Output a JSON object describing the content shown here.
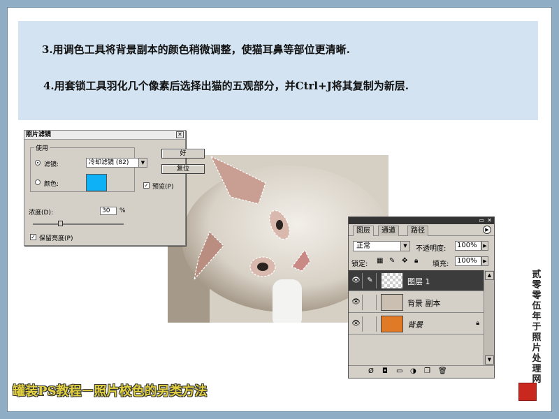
{
  "instructions": {
    "step1": "3.用调色工具将背景副本的颜色稍微调整，使猫耳鼻等部位更清晰.",
    "step2": "4.用套锁工具羽化几个像素后选择出猫的五观部分，并Ctrl+J将其复制为新层."
  },
  "photo_filter_dialog": {
    "title": "照片滤镜",
    "group_label": "使用",
    "filter_label": "滤镜:",
    "filter_value": "冷却滤镜 (82)",
    "color_label": "颜色:",
    "color_swatch": "#0eb0f6",
    "ok_label": "好",
    "reset_label": "复位",
    "preview_label": "预览(P)",
    "density_label": "浓度(D):",
    "density_value": "30",
    "density_unit": "%",
    "density_fraction": 0.3,
    "preserve_label": "保留亮度(P)"
  },
  "layers_panel": {
    "tabs": [
      "图层",
      "通道",
      "路径"
    ],
    "blend_mode": "正常",
    "opacity_label": "不透明度:",
    "opacity_value": "100%",
    "lock_label": "锁定:",
    "fill_label": "填充:",
    "fill_value": "100%",
    "layers": [
      {
        "name": "图层 1"
      },
      {
        "name": "背景 副本"
      },
      {
        "name": "背景"
      }
    ]
  },
  "footer": {
    "title": "罐装PS教程－照片校色的另类方法",
    "signature": "贰零零伍年于照片处理网"
  },
  "colors": {
    "frame": "#8faec6",
    "note_bg": "#d3e3f1",
    "title_gold": "#e0cf3e",
    "seal_red": "#c8281e"
  }
}
